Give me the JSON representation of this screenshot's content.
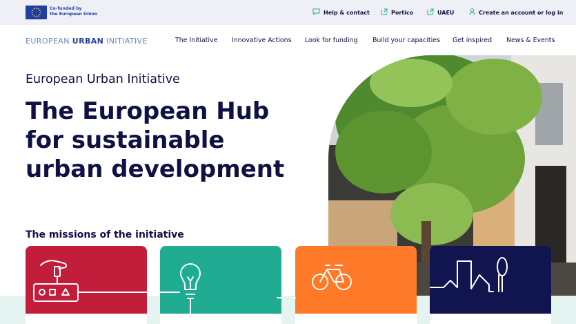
{
  "eu_badge": {
    "line1": "Co-funded by",
    "line2": "the European Union"
  },
  "utility_links": [
    {
      "label": "Help & contact"
    },
    {
      "label": "Portico"
    },
    {
      "label": "UAEU"
    },
    {
      "label": "Create an account or log in"
    }
  ],
  "brand": {
    "part1": "EUROPEAN ",
    "part2": "URBAN",
    "part3": " INITIATIVE"
  },
  "nav": [
    {
      "label": "The Initiative"
    },
    {
      "label": "Innovative Actions"
    },
    {
      "label": "Look for funding"
    },
    {
      "label": "Build your capacities"
    },
    {
      "label": "Get inspired"
    },
    {
      "label": "News & Events"
    }
  ],
  "hero": {
    "kicker": "European Urban Initiative",
    "title_line1": "The European Hub",
    "title_line2": "for sustainable",
    "title_line3": "urban development"
  },
  "missions": {
    "title": "The missions of the initiative"
  },
  "colors": {
    "red": "#c21d3a",
    "teal": "#1fac92",
    "orange": "#ff7a28",
    "navy": "#10144f",
    "brand": "#1f3fa6"
  }
}
